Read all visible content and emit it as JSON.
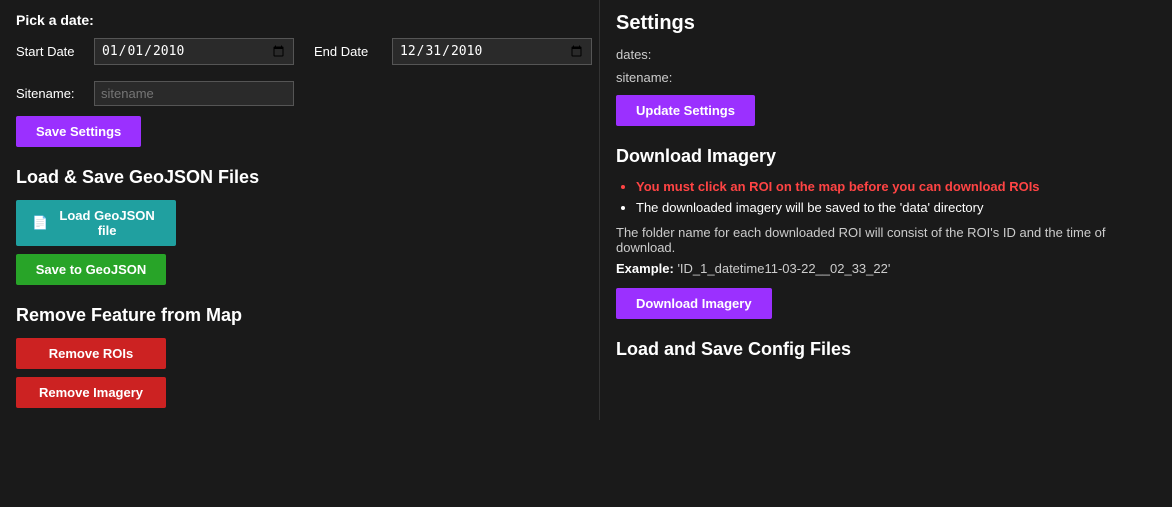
{
  "left": {
    "pick_date_label": "Pick a date:",
    "start_date_label": "Start Date",
    "start_date_value": "01/01/2010",
    "end_date_label": "End Date",
    "end_date_value": "12/31/2010",
    "sitename_label": "Sitename:",
    "sitename_placeholder": "sitename",
    "save_settings_btn": "Save Settings",
    "geojson_section_title": "Load & Save GeoJSON Files",
    "load_geojson_btn": "Load GeoJSON file",
    "save_geojson_btn": "Save to GeoJSON",
    "remove_section_title": "Remove Feature from Map",
    "remove_rois_btn": "Remove ROIs",
    "remove_imagery_btn": "Remove Imagery"
  },
  "right": {
    "settings_title": "Settings",
    "dates_label": "dates:",
    "sitename_label": "sitename:",
    "update_settings_btn": "Update Settings",
    "download_imagery_title": "Download Imagery",
    "bullet1": "You must click an ROI on the map before you can download ROIs",
    "bullet2": "The downloaded imagery will be saved to the 'data' directory",
    "info_text": "The folder name for each downloaded ROI will consist of the ROI's ID and the time of download.",
    "example_label": "Example:",
    "example_value": "'ID_1_datetime11-03-22__02_33_22'",
    "download_imagery_btn": "Download Imagery",
    "load_save_config_title": "Load and Save Config Files"
  }
}
